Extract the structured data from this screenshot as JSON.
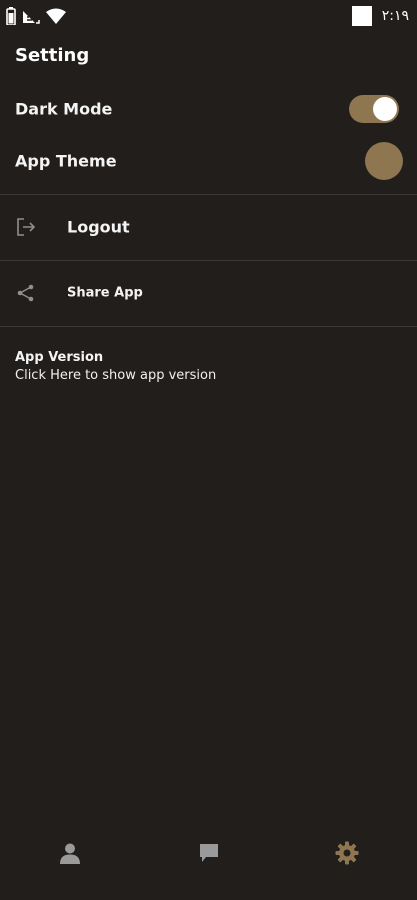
{
  "status_bar": {
    "time": "٢:١٩",
    "battery_icon": "battery-icon",
    "signal_icon": "signal-icon",
    "wifi_icon": "wifi-icon"
  },
  "page": {
    "title": "Setting"
  },
  "settings": {
    "dark_mode": {
      "label": "Dark Mode",
      "enabled": true
    },
    "app_theme": {
      "label": "App Theme",
      "color": "#8e7651"
    }
  },
  "menu": {
    "logout": {
      "label": "Logout",
      "icon": "logout-icon"
    },
    "share": {
      "label": "Share App",
      "icon": "share-icon"
    }
  },
  "version": {
    "title": "App Version",
    "subtitle": "Click Here to show app version"
  },
  "bottom_nav": {
    "items": [
      {
        "icon": "profile-icon",
        "active": false
      },
      {
        "icon": "chat-icon",
        "active": false
      },
      {
        "icon": "settings-icon",
        "active": true
      }
    ],
    "inactive_color": "#9a9a9a",
    "active_color": "#8e7651"
  },
  "colors": {
    "background": "#211e1b",
    "accent": "#8e7651",
    "divider": "#3c3935"
  }
}
